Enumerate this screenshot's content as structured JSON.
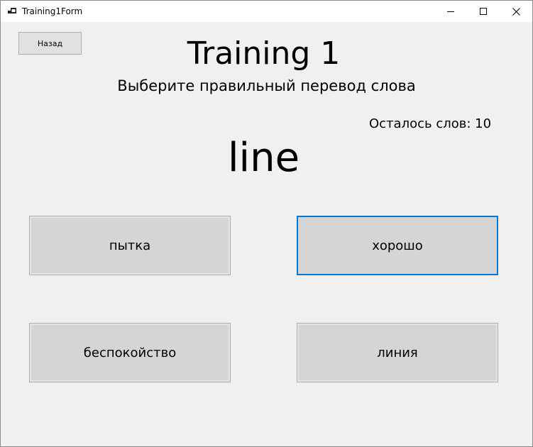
{
  "window": {
    "title": "Training1Form"
  },
  "header": {
    "back_label": "Назад",
    "title": "Training 1",
    "instruction": "Выберите правильный перевод слова",
    "remaining": "Осталось слов: 10"
  },
  "word": "line",
  "answers": [
    {
      "label": "пытка"
    },
    {
      "label": "хорошо"
    },
    {
      "label": "беспокойство"
    },
    {
      "label": "линия"
    }
  ],
  "colors": {
    "focus_border": "#0078d7",
    "button_face": "#d5d5d5",
    "form_background": "#f0f0f0"
  },
  "icons": {
    "app": "app-form-icon",
    "minimize": "minimize-icon",
    "maximize": "maximize-icon",
    "close": "close-icon"
  }
}
